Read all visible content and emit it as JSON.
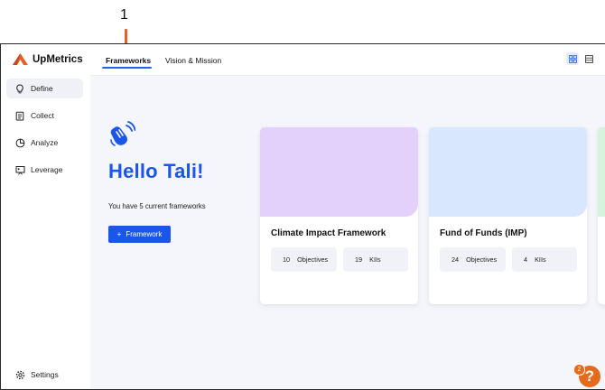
{
  "annotation": {
    "number": "1"
  },
  "brand": {
    "name": "UpMetrics",
    "accent": "#1a56e8",
    "logo_color": "#e0612a"
  },
  "sidebar": {
    "items": [
      {
        "label": "Define",
        "icon": "lightbulb-icon",
        "active": true
      },
      {
        "label": "Collect",
        "icon": "clipboard-icon",
        "active": false
      },
      {
        "label": "Analyze",
        "icon": "pie-chart-icon",
        "active": false
      },
      {
        "label": "Leverage",
        "icon": "presentation-icon",
        "active": false
      }
    ],
    "settings_label": "Settings"
  },
  "header": {
    "tabs": [
      {
        "label": "Frameworks",
        "active": true
      },
      {
        "label": "Vision & Mission",
        "active": false
      }
    ],
    "view_toggle": [
      "grid-view-icon",
      "list-view-icon"
    ]
  },
  "hero": {
    "title": "Hello Tali!",
    "subtitle": "You have 5 current frameworks",
    "button_label": "Framework",
    "button_icon": "plus-icon"
  },
  "cards": [
    {
      "title": "Climate Impact Framework",
      "color": "#e3d1fb",
      "objectives_count": "10",
      "objectives_label": "Objectives",
      "kiis_count": "19",
      "kiis_label": "KIIs"
    },
    {
      "title": "Fund of Funds (IMP)",
      "color": "#d8e6fe",
      "objectives_count": "24",
      "objectives_label": "Objectives",
      "kiis_count": "4",
      "kiis_label": "KIIs"
    }
  ],
  "help": {
    "badge": "2",
    "label": "?"
  }
}
